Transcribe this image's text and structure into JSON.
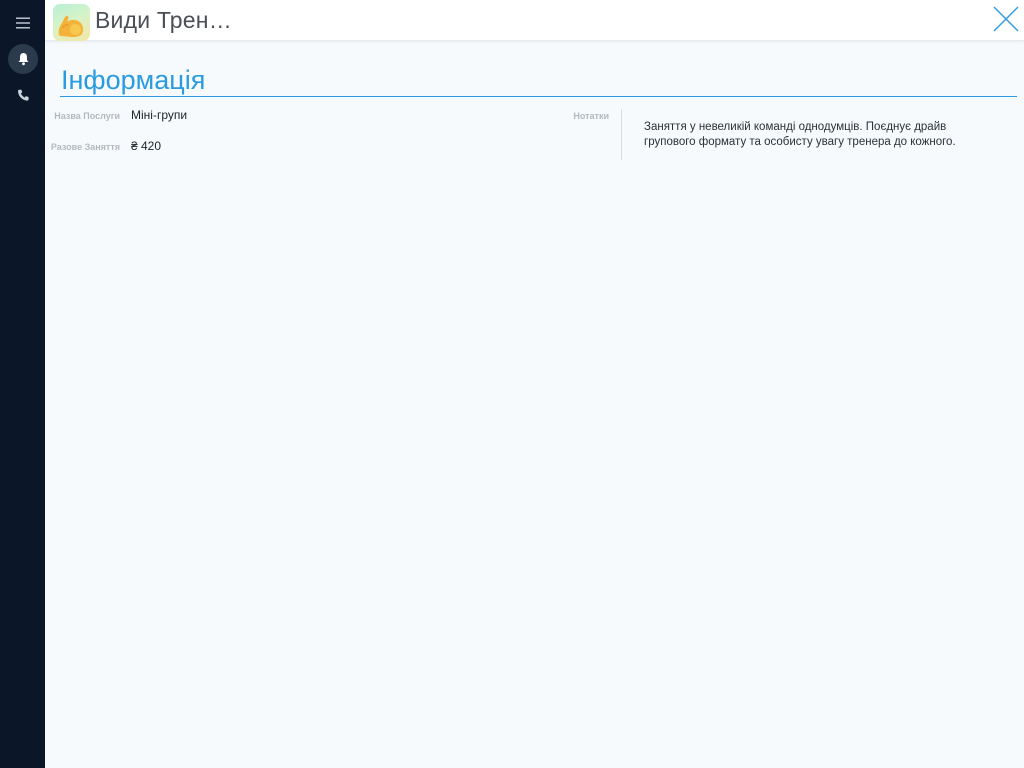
{
  "sidebar": {
    "items": [
      {
        "name": "menu",
        "icon": "hamburger-menu-icon"
      },
      {
        "name": "notifications",
        "icon": "bell-icon",
        "active": true
      },
      {
        "name": "phone",
        "icon": "phone-icon"
      }
    ]
  },
  "header": {
    "app_icon": "arm-muscle-icon",
    "title": "Види Трен…",
    "close_icon": "close-icon"
  },
  "section": {
    "title": "Інформація"
  },
  "fields": {
    "service_name_label": "Назва Послуги",
    "service_name_value": "Міні-групи",
    "single_session_label": "Разове Заняття",
    "single_session_value": "₴ 420",
    "notes_label": "Нотатки",
    "notes_value": "Заняття у невеликій команді однодумців. Поєднує драйв групового формату та особисту увагу тренера до кожного."
  },
  "colors": {
    "accent": "#2a9be0",
    "rail": "#0b1628",
    "background": "#f6fafc"
  }
}
